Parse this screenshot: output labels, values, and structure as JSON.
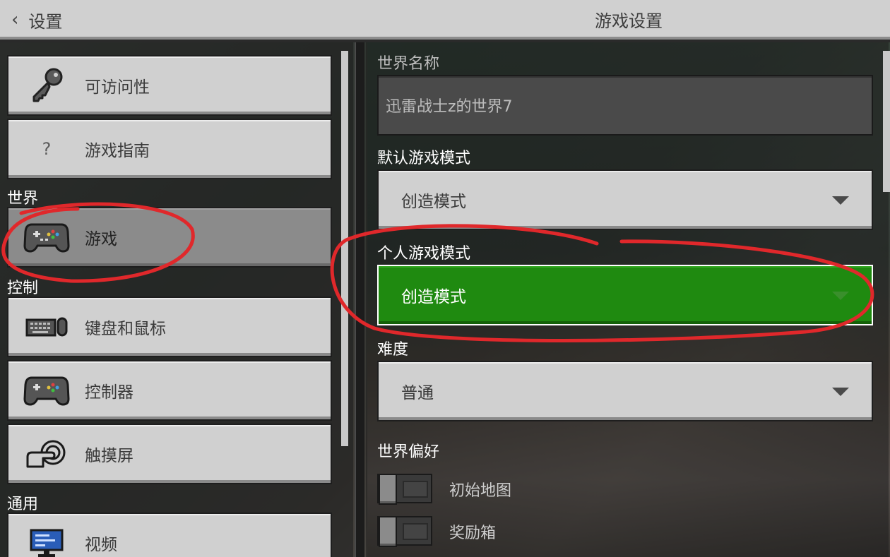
{
  "header": {
    "back_label": "设置",
    "title": "游戏设置"
  },
  "sidebar": {
    "items_top": [
      {
        "label": "可访问性",
        "icon": "key-icon"
      },
      {
        "label": "游戏指南",
        "icon": "question-icon",
        "icon_text": "?"
      }
    ],
    "sections": [
      {
        "label": "世界",
        "items": [
          {
            "label": "游戏",
            "icon": "gamepad-icon",
            "active": true
          }
        ]
      },
      {
        "label": "控制",
        "items": [
          {
            "label": "键盘和鼠标",
            "icon": "keyboard-mouse-icon"
          },
          {
            "label": "控制器",
            "icon": "gamepad-icon"
          },
          {
            "label": "触摸屏",
            "icon": "touch-hand-icon"
          }
        ]
      },
      {
        "label": "通用",
        "items": [
          {
            "label": "视频",
            "icon": "monitor-icon"
          }
        ]
      }
    ]
  },
  "main": {
    "world_name_label": "世界名称",
    "world_name_value": "迅雷战士z的世界7",
    "default_mode_label": "默认游戏模式",
    "default_mode_value": "创造模式",
    "personal_mode_label": "个人游戏模式",
    "personal_mode_value": "创造模式",
    "difficulty_label": "难度",
    "difficulty_value": "普通",
    "world_prefs_label": "世界偏好",
    "toggles": [
      {
        "label": "初始地图",
        "on": false
      },
      {
        "label": "奖励箱",
        "on": false
      }
    ]
  },
  "colors": {
    "accent_green": "#1f8a10",
    "annotation_red": "#e0282b"
  }
}
